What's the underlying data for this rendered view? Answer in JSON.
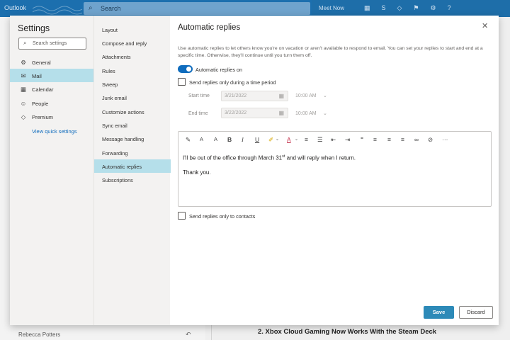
{
  "background": {
    "app_name": "Outlook",
    "search_placeholder": "Search",
    "meet_now": "Meet Now",
    "sender": "Rebecca Potters",
    "headline": "2. Xbox Cloud Gaming Now Works With the Steam Deck"
  },
  "settings": {
    "title": "Settings",
    "search_placeholder": "Search settings",
    "categories": [
      {
        "label": "General",
        "icon": "gear-icon"
      },
      {
        "label": "Mail",
        "icon": "mail-icon"
      },
      {
        "label": "Calendar",
        "icon": "calendar-icon"
      },
      {
        "label": "People",
        "icon": "people-icon"
      },
      {
        "label": "Premium",
        "icon": "diamond-icon"
      }
    ],
    "view_quick_settings": "View quick settings",
    "mail_sections": [
      "Layout",
      "Compose and reply",
      "Attachments",
      "Rules",
      "Sweep",
      "Junk email",
      "Customize actions",
      "Sync email",
      "Message handling",
      "Forwarding",
      "Automatic replies",
      "Subscriptions"
    ]
  },
  "auto_replies": {
    "title": "Automatic replies",
    "description": "Use automatic replies to let others know you're on vacation or aren't available to respond to email. You can set your replies to start and end at a specific time. Otherwise, they'll continue until you turn them off.",
    "toggle_label": "Automatic replies on",
    "toggle_on": true,
    "time_period_label": "Send replies only during a time period",
    "start_label": "Start time",
    "start_date": "3/21/2022",
    "start_time": "10:00 AM",
    "end_label": "End time",
    "end_date": "3/22/2022",
    "end_time": "10:00 AM",
    "message_line1_a": "I'll be out of the office through March 31",
    "message_line1_sup": "st",
    "message_line1_b": " and will reply when I return.",
    "message_line2": "Thank you.",
    "contacts_only_label": "Send replies only to contacts",
    "save_label": "Save",
    "discard_label": "Discard"
  },
  "colors": {
    "accent": "#0f6cbd",
    "selected_nav": "#b5dfea",
    "save_button": "#2d8ab8",
    "topbar": "#1c6fae"
  }
}
